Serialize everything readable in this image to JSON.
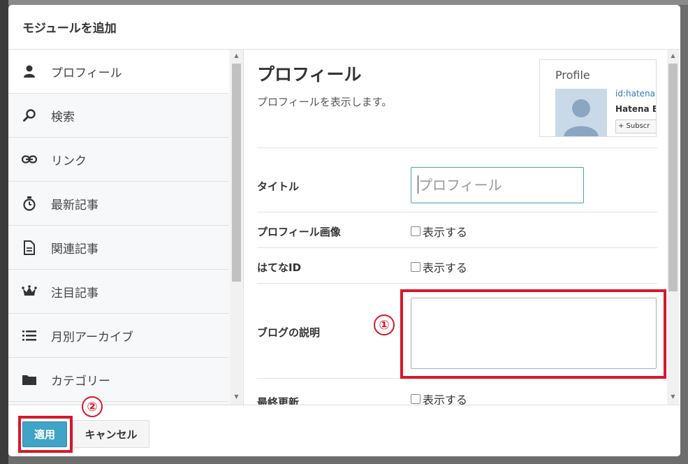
{
  "modal": {
    "title": "モジュールを追加"
  },
  "sidebar": {
    "items": [
      {
        "label": "プロフィール",
        "icon": "user-icon"
      },
      {
        "label": "検索",
        "icon": "search-icon"
      },
      {
        "label": "リンク",
        "icon": "link-icon"
      },
      {
        "label": "最新記事",
        "icon": "stopwatch-icon"
      },
      {
        "label": "関連記事",
        "icon": "document-icon"
      },
      {
        "label": "注目記事",
        "icon": "crown-icon"
      },
      {
        "label": "月別アーカイブ",
        "icon": "list-icon"
      },
      {
        "label": "カテゴリー",
        "icon": "folder-icon"
      }
    ]
  },
  "module": {
    "title": "プロフィール",
    "description": "プロフィールを表示します。",
    "preview": {
      "heading": "Profile",
      "id_text": "id:hatena",
      "name_text": "Hatena B",
      "subscribe_text": "+ Subscr"
    }
  },
  "form": {
    "title_label": "タイトル",
    "title_placeholder": "プロフィール",
    "profile_image_label": "プロフィール画像",
    "profile_image_check": "表示する",
    "hatena_id_label": "はてなID",
    "hatena_id_check": "表示する",
    "blog_desc_label": "ブログの説明",
    "last_updated_label": "最終更新",
    "last_updated_check": "表示する"
  },
  "annotations": {
    "one": "①",
    "two": "②"
  },
  "footer": {
    "apply_label": "適用",
    "cancel_label": "キャンセル"
  },
  "colors": {
    "accent": "#3fa4c5",
    "highlight": "#d7182a"
  }
}
